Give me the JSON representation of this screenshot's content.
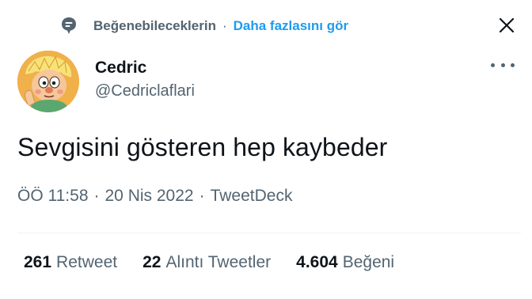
{
  "suggestion": {
    "icon": "heart-bubble-icon",
    "reason": "Beğenebileceklerin",
    "separator": "·",
    "more_link": "Daha fazlasını gör"
  },
  "close_icon": "close-icon",
  "author": {
    "name": "Cedric",
    "handle": "@Cedriclaflari",
    "avatar": "cartoon-avatar"
  },
  "more_icon": "more-horizontal-icon",
  "tweet": {
    "text": "Sevgisini gösteren hep kaybeder"
  },
  "meta": {
    "time": "ÖÖ 11:58",
    "sep1": "·",
    "date": "20 Nis 2022",
    "sep2": "·",
    "source": "TweetDeck"
  },
  "stats": {
    "retweets": {
      "count": "261",
      "label": "Retweet"
    },
    "quotes": {
      "count": "22",
      "label": "Alıntı Tweetler"
    },
    "likes": {
      "count": "4.604",
      "label": "Beğeni"
    }
  },
  "colors": {
    "accent": "#1d9bf0",
    "secondary_text": "#536471",
    "primary_text": "#0f1419"
  }
}
